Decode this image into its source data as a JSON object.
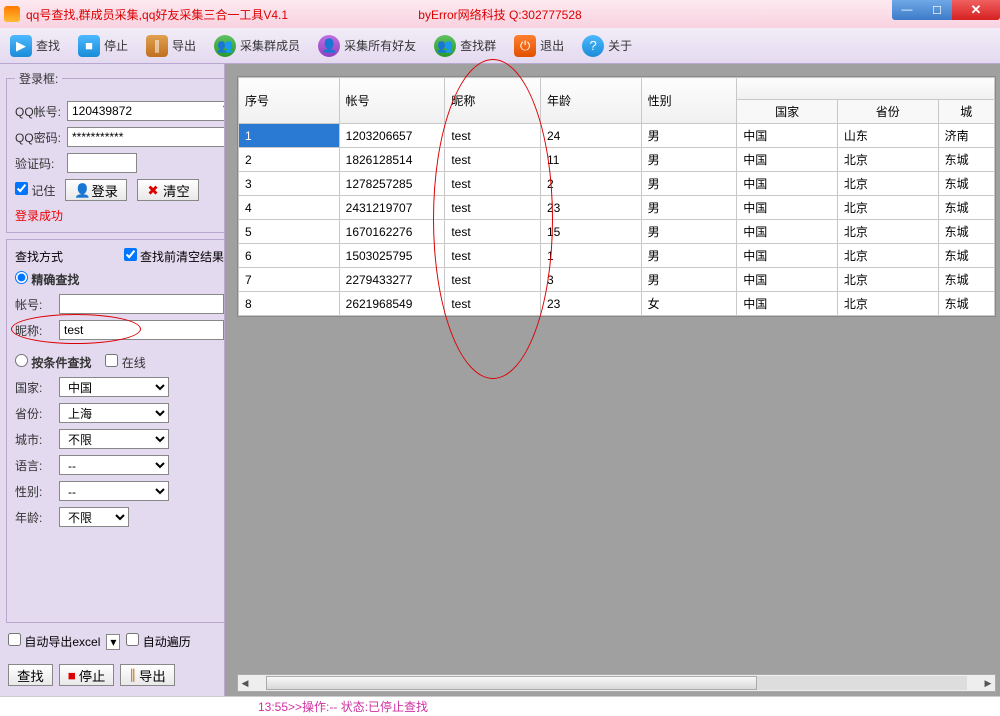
{
  "titlebar": {
    "title": "qq号查找,群成员采集,qq好友采集三合一工具V4.1",
    "center": "byError网络科技 Q:302777528"
  },
  "toolbar": {
    "find": "查找",
    "stop": "停止",
    "export": "导出",
    "collect_group": "采集群成员",
    "collect_friends": "采集所有好友",
    "find_group": "查找群",
    "exit": "退出",
    "about": "关于"
  },
  "login": {
    "legend": "登录框:",
    "acct_label": "QQ帐号:",
    "acct_value": "120439872",
    "pwd_label": "QQ密码:",
    "pwd_value": "***********",
    "captcha_label": "验证码:",
    "captcha_value": "",
    "remember": "记住",
    "login_btn": "登录",
    "clear_btn": "清空",
    "status": "登录成功"
  },
  "search": {
    "legend": "查找方式",
    "clear_before": "查找前清空结果",
    "exact": "精确查找",
    "acct_label": "帐号:",
    "acct_value": "",
    "nick_label": "昵称:",
    "nick_value": "test",
    "cond": "按条件查找",
    "online": "在线",
    "country_label": "国家:",
    "country": "中国",
    "province_label": "省份:",
    "province": "上海",
    "city_label": "城市:",
    "city": "不限",
    "lang_label": "语言:",
    "lang": "--",
    "gender_label": "性别:",
    "gender": "--",
    "age_label": "年龄:",
    "age": "不限"
  },
  "bottom": {
    "auto_export": "自动导出excel",
    "auto_traverse": "自动遍历",
    "find": "查找",
    "stop": "停止",
    "export": "导出"
  },
  "table": {
    "headers": {
      "seq": "序号",
      "acct": "帐号",
      "nick": "昵称",
      "age": "年龄",
      "gender": "性别",
      "country": "国家",
      "province": "省份",
      "city": "城"
    },
    "rows": [
      {
        "seq": "1",
        "acct": "1203206657",
        "nick": "test",
        "age": "24",
        "gender": "男",
        "country": "中国",
        "province": "山东",
        "city": "济南"
      },
      {
        "seq": "2",
        "acct": "1826128514",
        "nick": "test",
        "age": "11",
        "gender": "男",
        "country": "中国",
        "province": "北京",
        "city": "东城"
      },
      {
        "seq": "3",
        "acct": "1278257285",
        "nick": "test",
        "age": "2",
        "gender": "男",
        "country": "中国",
        "province": "北京",
        "city": "东城"
      },
      {
        "seq": "4",
        "acct": "2431219707",
        "nick": "test",
        "age": "23",
        "gender": "男",
        "country": "中国",
        "province": "北京",
        "city": "东城"
      },
      {
        "seq": "5",
        "acct": "1670162276",
        "nick": "test",
        "age": "15",
        "gender": "男",
        "country": "中国",
        "province": "北京",
        "city": "东城"
      },
      {
        "seq": "6",
        "acct": "1503025795",
        "nick": "test",
        "age": "1",
        "gender": "男",
        "country": "中国",
        "province": "北京",
        "city": "东城"
      },
      {
        "seq": "7",
        "acct": "2279433277",
        "nick": "test",
        "age": "3",
        "gender": "男",
        "country": "中国",
        "province": "北京",
        "city": "东城"
      },
      {
        "seq": "8",
        "acct": "2621968549",
        "nick": "test",
        "age": "23",
        "gender": "女",
        "country": "中国",
        "province": "北京",
        "city": "东城"
      }
    ]
  },
  "status": "13:55>>操作:-- 状态:已停止查找"
}
